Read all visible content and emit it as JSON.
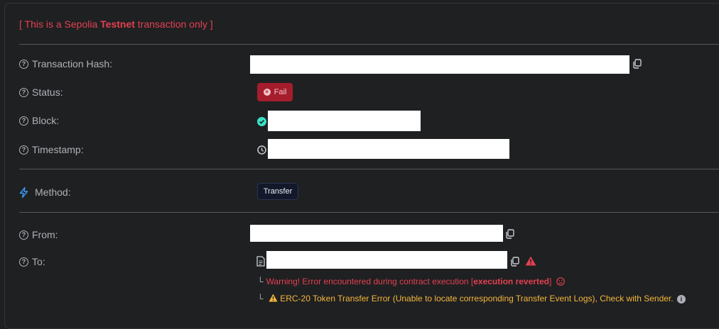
{
  "banner": {
    "prefix": "[ This is a Sepolia ",
    "bold": "Testnet",
    "suffix": " transaction only ]"
  },
  "rows": {
    "tx_hash_label": "Transaction Hash:",
    "status_label": "Status:",
    "block_label": "Block:",
    "timestamp_label": "Timestamp:",
    "method_label": "Method:",
    "from_label": "From:",
    "to_label": "To:"
  },
  "status": {
    "text": "Fail"
  },
  "method": {
    "text": "Transfer"
  },
  "warnings": {
    "line1_prefix": "Warning! Error encountered during contract execution [",
    "line1_bold": "execution reverted",
    "line1_suffix": "]",
    "line2": "ERC-20 Token Transfer Error (Unable to locate corresponding Transfer Event Logs), Check with Sender."
  },
  "colors": {
    "error_red": "#e34050",
    "warning_amber": "#f5b73b",
    "fail_badge_bg": "#a51d2d",
    "method_icon": "#3b9bf5",
    "block_check": "#37e2c7"
  }
}
